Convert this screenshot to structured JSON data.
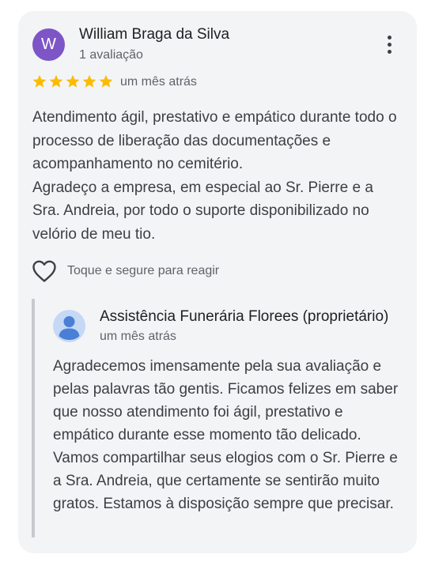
{
  "review": {
    "avatar_initial": "W",
    "avatar_color": "#7d55c7",
    "author_name": "William Braga da Silva",
    "author_meta": "1 avaliação",
    "rating": 5,
    "max_rating": 5,
    "star_color": "#fbbc04",
    "date": "um mês atrás",
    "text_lines": [
      "Atendimento ágil, prestativo e empático durante todo o processo de liberação das documentações e acompanhamento no cemitério.",
      "Agradeço a empresa, em especial ao Sr. Pierre e a Sra. Andreia, por todo o suporte disponibilizado no velório de meu tio."
    ],
    "more_options_icon": "more-vert-icon"
  },
  "reaction": {
    "icon": "heart-outline-icon",
    "label": "Toque e segure para reagir"
  },
  "owner_reply": {
    "avatar_icon": "default-person-icon",
    "avatar_color": "#c5d8f5",
    "name": "Assistência Funerária Florees (proprietário)",
    "date": "um mês atrás",
    "text": "Agradecemos imensamente pela sua avaliação e pelas palavras tão gentis. Ficamos felizes em saber que nosso atendimento foi ágil, prestativo e empático durante esse momento tão delicado. Vamos compartilhar seus elogios com o Sr. Pierre e a Sra. Andreia, que certamente se sentirão muito gratos. Estamos à disposição sempre que precisar."
  }
}
